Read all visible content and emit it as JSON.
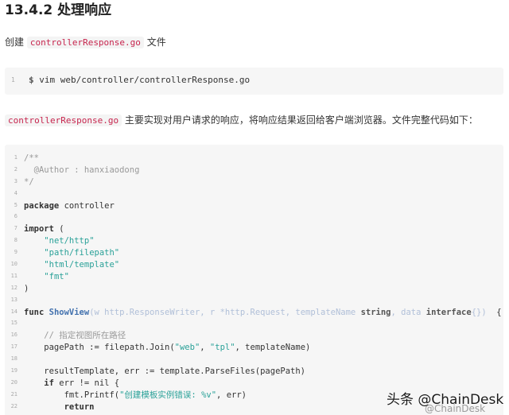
{
  "heading": "13.4.2 处理响应",
  "para1": {
    "prefix": "创建",
    "file": "controllerResponse.go",
    "suffix": "文件"
  },
  "command": {
    "line": "1",
    "prompt": "$",
    "text": "vim web/controller/controllerResponse.go"
  },
  "para2": {
    "file": "controllerResponse.go",
    "text": "主要实现对用户请求的响应，将响应结果返回给客户端浏览器。文件完整代码如下："
  },
  "code": {
    "line_numbers": [
      "1",
      "2",
      "3",
      "4",
      "5",
      "6",
      "7",
      "8",
      "9",
      "10",
      "11",
      "12",
      "13",
      "14",
      "15",
      "16",
      "17",
      "18",
      "19",
      "20",
      "21",
      "22"
    ],
    "lines": [
      [
        {
          "t": "/**",
          "k": "cm"
        }
      ],
      [
        {
          "t": "  @Author : hanxiaodong",
          "k": "cm"
        }
      ],
      [
        {
          "t": "*/",
          "k": "cm"
        }
      ],
      [],
      [
        {
          "t": "package",
          "k": "kw"
        },
        {
          "t": " controller",
          "k": "id"
        }
      ],
      [],
      [
        {
          "t": "import",
          "k": "kw"
        },
        {
          "t": " (",
          "k": "id"
        }
      ],
      [
        {
          "t": "    ",
          "k": "id"
        },
        {
          "t": "\"net/http\"",
          "k": "str"
        }
      ],
      [
        {
          "t": "    ",
          "k": "id"
        },
        {
          "t": "\"path/filepath\"",
          "k": "str"
        }
      ],
      [
        {
          "t": "    ",
          "k": "id"
        },
        {
          "t": "\"html/template\"",
          "k": "str"
        }
      ],
      [
        {
          "t": "    ",
          "k": "id"
        },
        {
          "t": "\"fmt\"",
          "k": "str"
        }
      ],
      [
        {
          "t": ")",
          "k": "id"
        }
      ],
      [],
      [
        {
          "t": "func",
          "k": "kw"
        },
        {
          "t": " ",
          "k": "id"
        },
        {
          "t": "ShowView",
          "k": "fn"
        },
        {
          "t": "(w http.ResponseWriter, r *http.Request, templateName ",
          "k": "pr"
        },
        {
          "t": "string",
          "k": "pt"
        },
        {
          "t": ", data ",
          "k": "pr"
        },
        {
          "t": "interface",
          "k": "pt"
        },
        {
          "t": "{})",
          "k": "pr"
        },
        {
          "t": "  {",
          "k": "id"
        }
      ],
      [],
      [
        {
          "t": "    // 指定视图所在路径",
          "k": "cm"
        }
      ],
      [
        {
          "t": "    pagePath := filepath.Join(",
          "k": "id"
        },
        {
          "t": "\"web\"",
          "k": "str"
        },
        {
          "t": ", ",
          "k": "id"
        },
        {
          "t": "\"tpl\"",
          "k": "str"
        },
        {
          "t": ", templateName)",
          "k": "id"
        }
      ],
      [],
      [
        {
          "t": "    resultTemplate, err := template.ParseFiles(pagePath)",
          "k": "id"
        }
      ],
      [
        {
          "t": "    ",
          "k": "id"
        },
        {
          "t": "if",
          "k": "kw"
        },
        {
          "t": " err != nil {",
          "k": "id"
        }
      ],
      [
        {
          "t": "        fmt.Printf(",
          "k": "id"
        },
        {
          "t": "\"创建模板实例错误: %v\"",
          "k": "str"
        },
        {
          "t": ", err)",
          "k": "id"
        }
      ],
      [
        {
          "t": "        ",
          "k": "id"
        },
        {
          "t": "return",
          "k": "kw"
        }
      ]
    ]
  },
  "watermark": {
    "main": "头条 @ChainDesk",
    "sub": "@ChainDesk"
  }
}
